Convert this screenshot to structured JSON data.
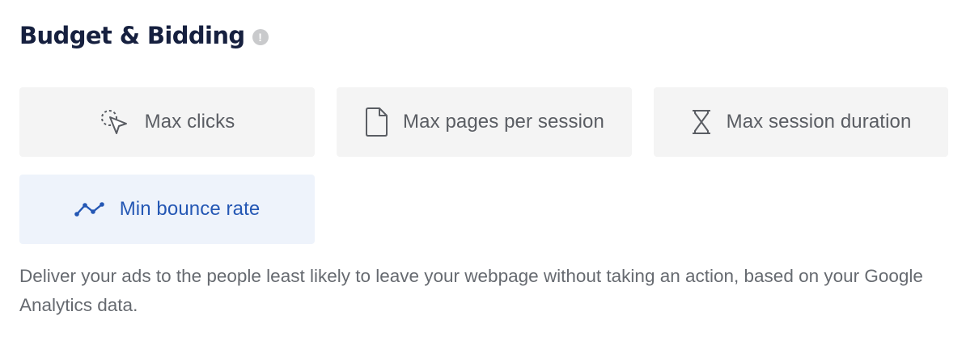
{
  "section": {
    "title": "Budget & Bidding"
  },
  "options": [
    {
      "label": "Max clicks",
      "icon": "cursor-click-icon",
      "selected": false
    },
    {
      "label": "Max pages per session",
      "icon": "page-icon",
      "selected": false
    },
    {
      "label": "Max session duration",
      "icon": "hourglass-icon",
      "selected": false
    },
    {
      "label": "Min bounce rate",
      "icon": "line-chart-icon",
      "selected": true
    }
  ],
  "description": "Deliver your ads to the people least likely to leave your webpage without taking an action, based on your Google Analytics data.",
  "colors": {
    "heading": "#16203f",
    "option_bg": "#f4f4f4",
    "selected_bg": "#eef3fb",
    "selected_accent": "#2457b4",
    "text_muted": "#666a70"
  }
}
